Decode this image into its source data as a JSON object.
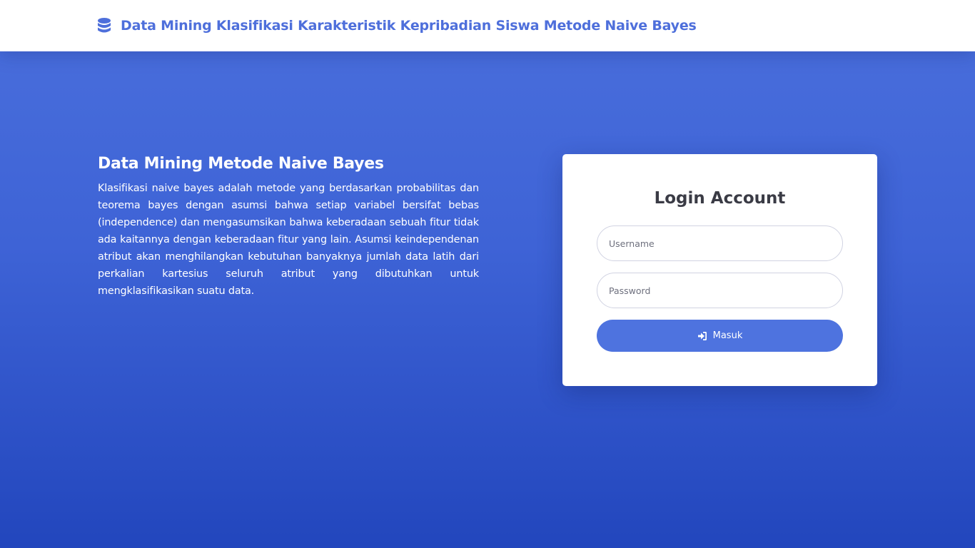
{
  "header": {
    "icon": "database-icon",
    "title": "Data Mining Klasifikasi Karakteristik Kepribadian Siswa Metode Naive Bayes"
  },
  "intro": {
    "heading": "Data Mining Metode Naive Bayes",
    "text": "Klasifikasi naive bayes adalah metode yang berdasarkan probabilitas dan teorema bayes dengan asumsi bahwa setiap variabel bersifat bebas (independence) dan mengasumsikan bahwa keberadaan sebuah fitur tidak ada kaitannya dengan keberadaan fitur yang lain. Asumsi keindependenan atribut akan menghilangkan kebutuhan banyaknya jumlah data latih dari perkalian kartesius seluruh atribut yang dibutuhkan untuk mengklasifikasikan suatu data."
  },
  "login": {
    "title": "Login Account",
    "username_placeholder": "Username",
    "username_value": "",
    "password_placeholder": "Password",
    "password_value": "",
    "submit_label": "Masuk",
    "submit_icon": "sign-in-icon"
  },
  "colors": {
    "brand": "#4e73df",
    "background_top": "#4a6fdc",
    "background_bottom": "#2246bd",
    "card": "#ffffff",
    "title_text": "#3a3b45"
  }
}
